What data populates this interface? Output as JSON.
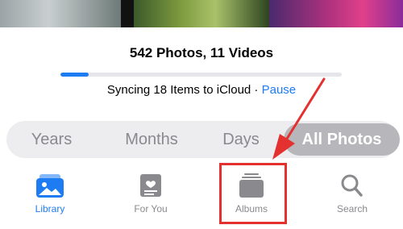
{
  "library": {
    "counts": "542 Photos, 11 Videos",
    "sync_progress": 0.1
  },
  "sync": {
    "status_text": "Syncing 18 Items to iCloud · ",
    "pause_label": "Pause"
  },
  "segments": {
    "years": "Years",
    "months": "Months",
    "days": "Days",
    "all_photos": "All Photos",
    "selected": "All Photos"
  },
  "tabbar": {
    "library_label": "Library",
    "foryou_label": "For You",
    "albums_label": "Albums",
    "search_label": "Search",
    "active": "Library"
  },
  "icons": {
    "library": "photo-stack-icon",
    "foryou": "for-you-icon",
    "albums": "albums-icon",
    "search": "search-icon"
  },
  "colors": {
    "accent": "#1e7cf2",
    "annotation": "#e53030",
    "inactive": "#8a8a8e"
  }
}
